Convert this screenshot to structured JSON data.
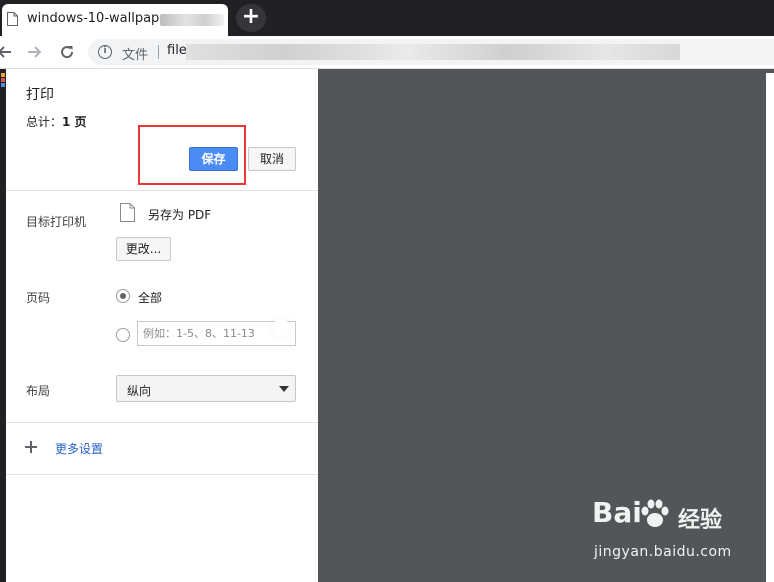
{
  "browser": {
    "tab_title": "windows-10-wallpaper",
    "new_tab_symbol": "+",
    "back_icon": "arrow-left-icon",
    "forward_icon": "arrow-right-icon",
    "reload_icon": "reload-icon",
    "address_label": "文件",
    "address_url": "file"
  },
  "print": {
    "title": "打印",
    "total_prefix": "总计：",
    "total_pages": "1 页",
    "save_label": "保存",
    "cancel_label": "取消",
    "destination_label": "目标打印机",
    "destination_value": "另存为 PDF",
    "change_label": "更改...",
    "pages_label": "页码",
    "pages_all": "全部",
    "pages_custom_placeholder": "例如：1-5、8、11-13",
    "layout_label": "布局",
    "layout_value": "纵向",
    "more_settings": "更多设置"
  },
  "watermark": {
    "brand": "Bai",
    "brand_suffix": "经验",
    "url": "jingyan.baidu.com"
  },
  "colors": {
    "save_button": "#4b8bf4",
    "highlight_box": "#e53935",
    "preview_bg": "#525659",
    "link": "#2a63c8"
  }
}
